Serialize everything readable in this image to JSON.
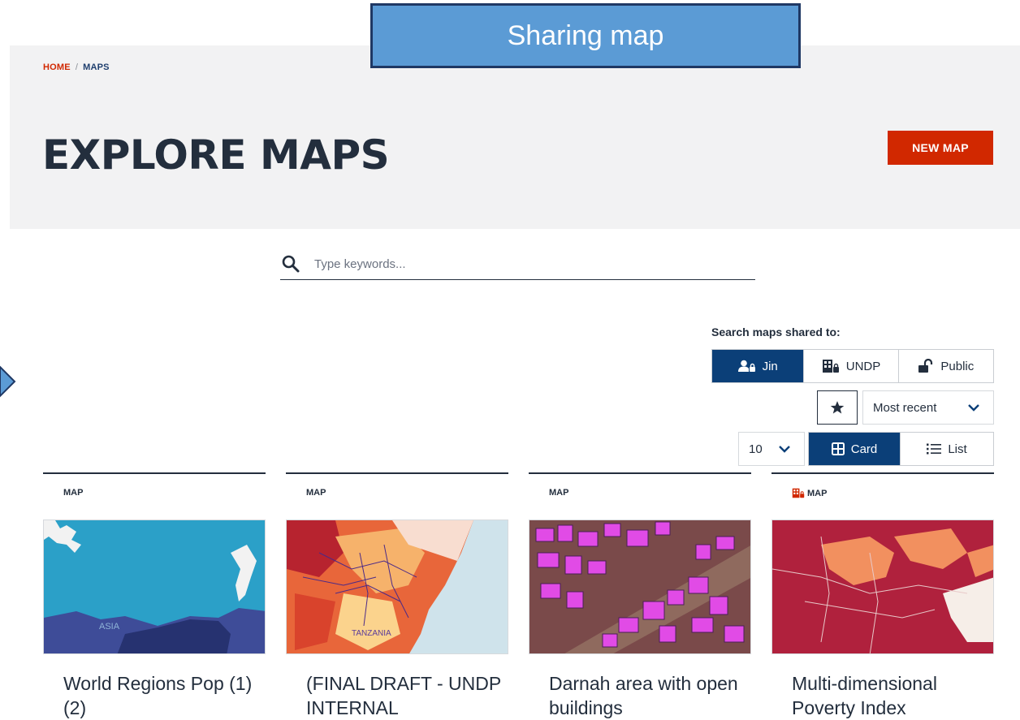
{
  "overlay": {
    "banner_text": "Sharing map"
  },
  "breadcrumb": {
    "home": "HOME",
    "separator": "/",
    "current": "MAPS"
  },
  "header": {
    "title": "EXPLORE MAPS",
    "new_map_label": "NEW MAP"
  },
  "search": {
    "placeholder": "Type keywords...",
    "value": ""
  },
  "filters": {
    "shared_label": "Search maps shared to:",
    "share_options": [
      {
        "label": "Jin",
        "icon": "user-lock-icon",
        "active": true
      },
      {
        "label": "UNDP",
        "icon": "building-lock-icon",
        "active": false
      },
      {
        "label": "Public",
        "icon": "unlock-icon",
        "active": false
      }
    ],
    "favorites_icon": "star-icon",
    "sort": "Most recent",
    "per_page": "10",
    "view_options": [
      {
        "label": "Card",
        "icon": "grid-icon",
        "active": true
      },
      {
        "label": "List",
        "icon": "list-icon",
        "active": false
      }
    ]
  },
  "cards": [
    {
      "type": "MAP",
      "title": "World Regions Pop (1) (2)",
      "thumb_label": "ASIA"
    },
    {
      "type": "MAP",
      "title": "(FINAL DRAFT - UNDP INTERNAL",
      "thumb_label": "TANZANIA"
    },
    {
      "type": "MAP",
      "title": "Darnah area with open buildings",
      "thumb_label": ""
    },
    {
      "type": "MAP",
      "title": "Multi-dimensional Poverty Index",
      "thumb_label": "",
      "type_icon": "building-lock-icon"
    }
  ],
  "colors": {
    "accent_red": "#D12800",
    "primary_navy": "#0B3F78",
    "text_dark": "#232E3D",
    "header_bg": "#F2F2F3",
    "banner_blue": "#5B9BD5"
  }
}
